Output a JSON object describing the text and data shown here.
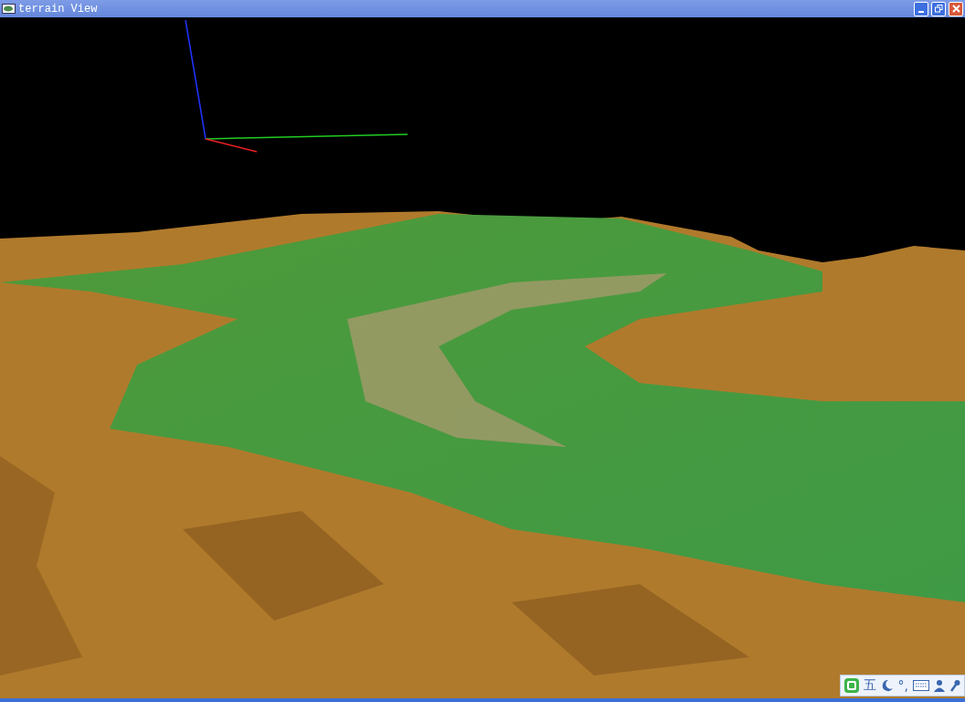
{
  "window": {
    "title": "terrain View"
  },
  "ime_toolbar": {
    "mode": "五",
    "punctuation": "°,"
  }
}
